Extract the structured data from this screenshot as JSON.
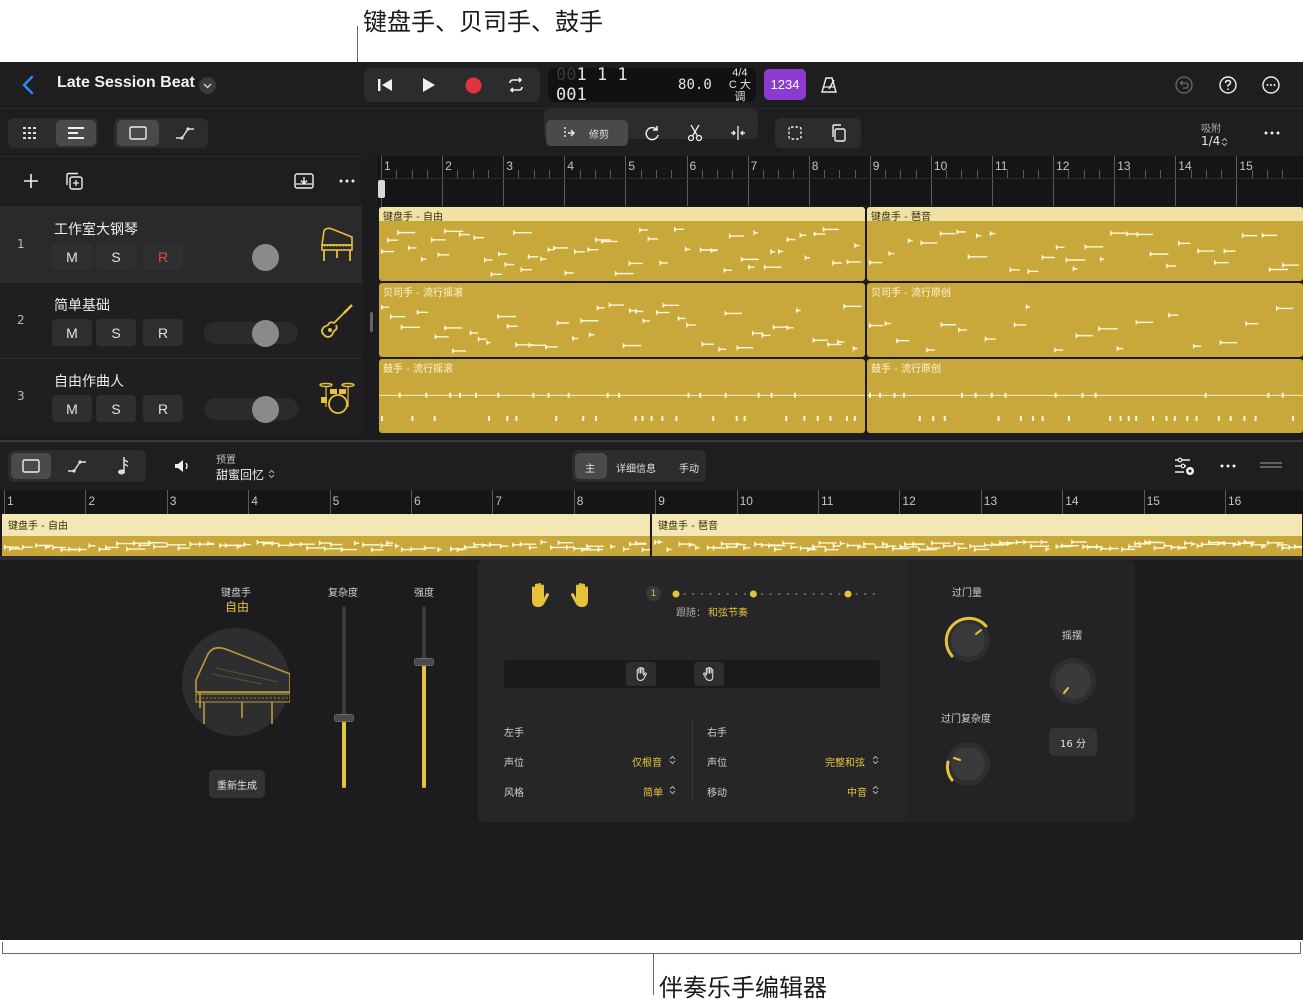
{
  "callouts": {
    "top": "键盘手、贝司手、鼓手",
    "bottom": "伴奏乐手编辑器"
  },
  "header": {
    "title": "Late Session Beat",
    "lcd": {
      "position_dim": "00",
      "position": "1 1 1 001",
      "tempo": "80.0",
      "time_sig": "4/4",
      "key": "C 大调"
    },
    "count_in": "1234"
  },
  "toolbar": {
    "trim_label": "修剪",
    "snap_label": "吸附",
    "snap_value": "1/4"
  },
  "tracks": [
    {
      "num": "1",
      "name": "工作室大钢琴",
      "m": "M",
      "s": "S",
      "r": "R",
      "icon": "grand-piano-icon"
    },
    {
      "num": "2",
      "name": "简单基础",
      "m": "M",
      "s": "S",
      "r": "R",
      "icon": "bass-guitar-icon"
    },
    {
      "num": "3",
      "name": "自由作曲人",
      "m": "M",
      "s": "S",
      "r": "R",
      "icon": "drum-kit-icon"
    }
  ],
  "ruler_bars": [
    "1",
    "2",
    "3",
    "4",
    "5",
    "6",
    "7",
    "8",
    "9",
    "10",
    "11",
    "12",
    "13",
    "14",
    "15"
  ],
  "regions": {
    "keys_a": "键盘手 - 自由",
    "keys_b": "键盘手 - 琶音",
    "bass_a": "贝司手 - 流行摇滚",
    "bass_b": "贝司手 - 流行原创",
    "drums_a": "鼓手 - 流行摇滚",
    "drums_b": "鼓手 - 流行原创"
  },
  "editor": {
    "preset_label": "预置",
    "preset_value": "甜蜜回忆",
    "tabs": [
      "主",
      "详细信息",
      "手动"
    ],
    "ruler_bars": [
      "1",
      "2",
      "3",
      "4",
      "5",
      "6",
      "7",
      "8",
      "9",
      "10",
      "11",
      "12",
      "13",
      "14",
      "15",
      "16"
    ],
    "region_a": "键盘手 - 自由",
    "region_b": "键盘手 - 琶音",
    "player_label": "键盘手",
    "player_style": "自由",
    "regenerate": "重新生成",
    "complexity": "复杂度",
    "intensity": "强度",
    "follow_label": "跟随：",
    "follow_value": "和弦节奏",
    "pattern_num": "1",
    "left_hand": "左手",
    "right_hand": "右手",
    "lh_voicing_label": "声位",
    "lh_voicing_value": "仅根音",
    "lh_style_label": "风格",
    "lh_style_value": "简单",
    "rh_voicing_label": "声位",
    "rh_voicing_value": "完整和弦",
    "rh_move_label": "移动",
    "rh_move_value": "中音",
    "fill_amount": "过门量",
    "fill_complexity": "过门复杂度",
    "swing": "摇摆",
    "swing_value": "16 分"
  },
  "colors": {
    "accent": "#e6c23a",
    "region": "#c8a83b",
    "record": "#e0353a",
    "count_in": "#8c3bd0"
  }
}
